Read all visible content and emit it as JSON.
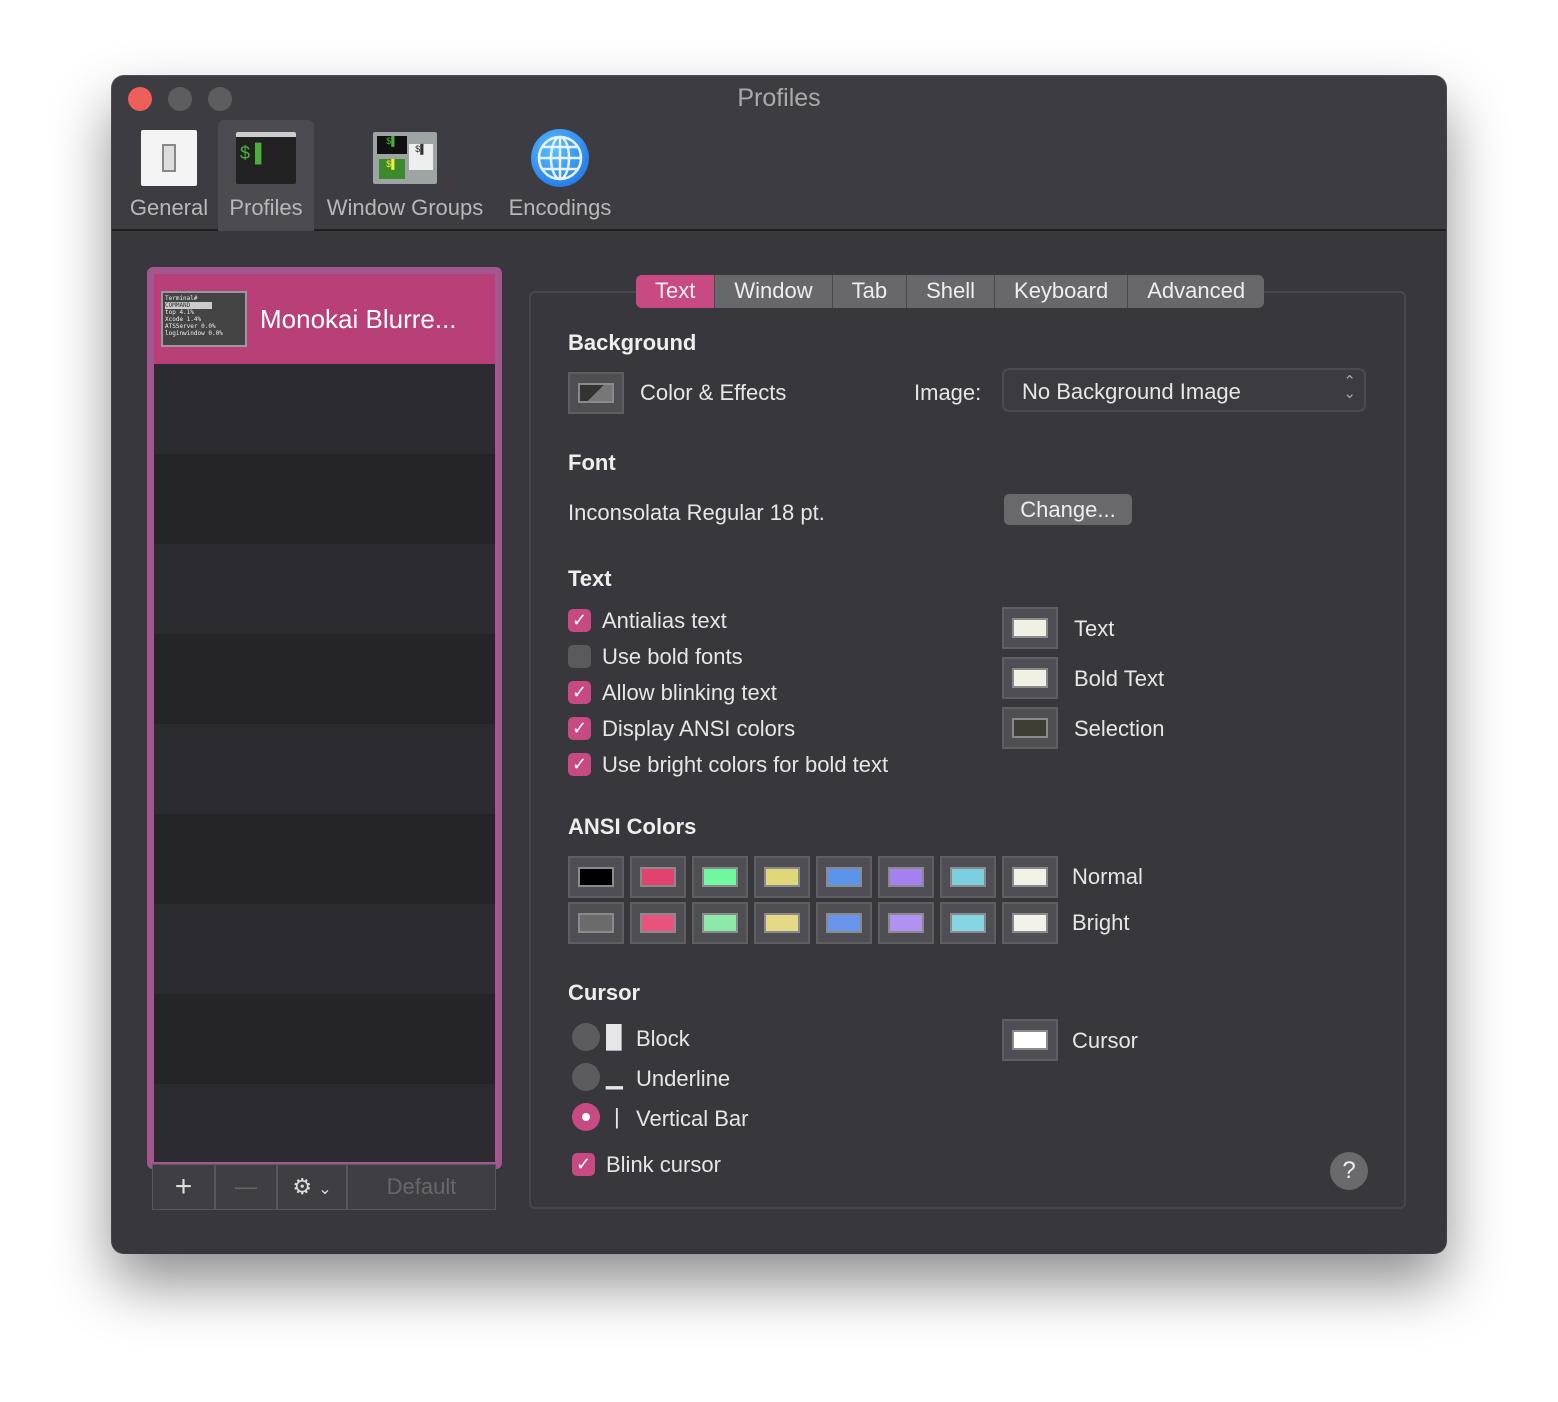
{
  "window": {
    "title": "Profiles"
  },
  "toolbar": [
    {
      "label": "General",
      "icon": "switch-icon"
    },
    {
      "label": "Profiles",
      "icon": "terminal-icon",
      "selected": true
    },
    {
      "label": "Window Groups",
      "icon": "window-groups-icon"
    },
    {
      "label": "Encodings",
      "icon": "globe-icon"
    }
  ],
  "profiles": {
    "items": [
      {
        "name": "Monokai Blurre...",
        "selected": true
      }
    ],
    "thumb_lines": [
      "Terminal#",
      "top        4.1%",
      "Xcode      1.4%",
      "ATSServer  0.0%",
      "loginwindow 0.0%"
    ],
    "add": "+",
    "remove": "—",
    "default_label": "Default"
  },
  "tabs": [
    "Text",
    "Window",
    "Tab",
    "Shell",
    "Keyboard",
    "Advanced"
  ],
  "active_tab": "Text",
  "background": {
    "heading": "Background",
    "color_effects": "Color & Effects",
    "image_label": "Image:",
    "image_value": "No Background Image"
  },
  "font": {
    "heading": "Font",
    "value": "Inconsolata Regular 18 pt.",
    "change": "Change..."
  },
  "text": {
    "heading": "Text",
    "options": [
      {
        "label": "Antialias text",
        "checked": true
      },
      {
        "label": "Use bold fonts",
        "checked": false
      },
      {
        "label": "Allow blinking text",
        "checked": true
      },
      {
        "label": "Display ANSI colors",
        "checked": true
      },
      {
        "label": "Use bright colors for bold text",
        "checked": true
      }
    ],
    "colors": [
      {
        "label": "Text",
        "color": "#f1f0e4"
      },
      {
        "label": "Bold Text",
        "color": "#f1f0e4"
      },
      {
        "label": "Selection",
        "color": "#3e3d32"
      }
    ]
  },
  "ansi": {
    "heading": "ANSI Colors",
    "normal_label": "Normal",
    "bright_label": "Bright",
    "normal": [
      "#000000",
      "#e2436e",
      "#71f79f",
      "#e0d67a",
      "#5c94ec",
      "#a480f0",
      "#7ad0e0",
      "#f2f1e6"
    ],
    "bright": [
      "#6b6b6b",
      "#e7527f",
      "#8ee8a8",
      "#e4da85",
      "#6995ec",
      "#b093f0",
      "#86d5e3",
      "#f3f2ea"
    ]
  },
  "cursor": {
    "heading": "Cursor",
    "options": [
      {
        "label": "Block",
        "glyph": "█",
        "selected": false
      },
      {
        "label": "Underline",
        "glyph": "▁",
        "selected": false
      },
      {
        "label": "Vertical Bar",
        "glyph": "|",
        "selected": true
      }
    ],
    "blink_label": "Blink cursor",
    "blink": true,
    "color_label": "Cursor",
    "color": "#ffffff"
  },
  "help": "?",
  "accent": "#c84a82"
}
